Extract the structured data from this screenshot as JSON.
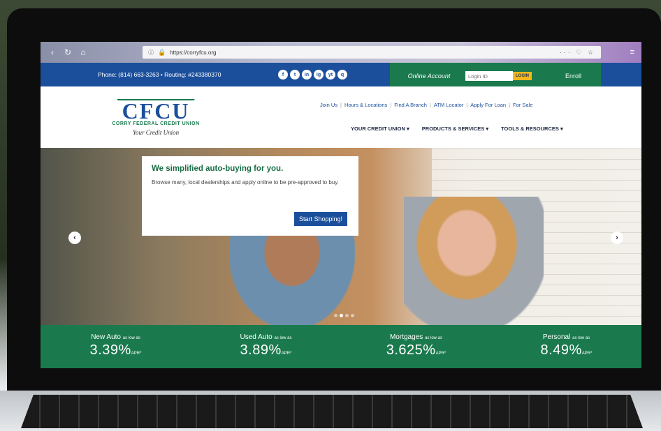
{
  "browser": {
    "url": "https://corryfcu.org",
    "tools": "··· ♡ ☆"
  },
  "topbar": {
    "contact": "Phone: (814) 663-3263 • Routing: #243380370",
    "social": [
      "f",
      "t",
      "in",
      "ig",
      "yt",
      "q"
    ]
  },
  "login": {
    "title": "Online Account",
    "placeholder": "Login ID",
    "button": "LOGIN",
    "enroll": "Enroll"
  },
  "logo": {
    "abbr": "CFCU",
    "name": "CORRY FEDERAL CREDIT UNION",
    "tagline": "Your Credit Union"
  },
  "quicklinks": [
    "Join Us",
    "Hours & Locations",
    "Find A Branch",
    "ATM Locator",
    "Apply For Loan",
    "For Sale"
  ],
  "mainnav": [
    "YOUR CREDIT UNION ▾",
    "PRODUCTS & SERVICES ▾",
    "TOOLS & RESOURCES ▾"
  ],
  "promo": {
    "title": "We simplified auto-buying for you.",
    "body": "Browse many, local dealerships and apply online to be pre-approved to buy.",
    "button": "Start Shopping!"
  },
  "rates": [
    {
      "name": "New Auto",
      "qual": "as low as",
      "value": "3.39%",
      "unit": "APR*"
    },
    {
      "name": "Used Auto",
      "qual": "as low as",
      "value": "3.89%",
      "unit": "APR*"
    },
    {
      "name": "Mortgages",
      "qual": "as low as",
      "value": "3.625%",
      "unit": "APR*"
    },
    {
      "name": "Personal",
      "qual": "as low as",
      "value": "8.49%",
      "unit": "APR*"
    }
  ],
  "colors": {
    "brand_blue": "#1b4f9c",
    "brand_green": "#1a7a4d",
    "accent_yellow": "#f2b71b"
  }
}
